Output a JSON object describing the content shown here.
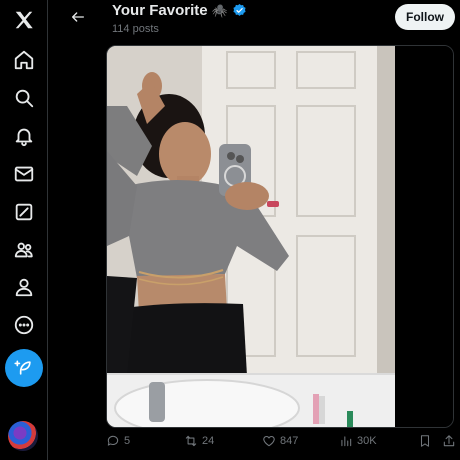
{
  "header": {
    "name": "Your Favorite",
    "name_emoji": "🕷️",
    "posts_count": "114 posts",
    "follow_label": "Follow"
  },
  "nav": {
    "items": [
      "x-logo-icon",
      "home-icon",
      "explore-icon",
      "notifications-icon",
      "messages-icon",
      "grok-icon",
      "communities-icon",
      "profile-icon",
      "more-icon"
    ],
    "compose": "compose-post-icon"
  },
  "actions": {
    "replies": "5",
    "reposts": "24",
    "likes": "847",
    "views": "30K"
  },
  "colors": {
    "accent": "#1d9bf0",
    "background": "#000000",
    "text": "#e7e9ea",
    "muted": "#71767b"
  }
}
